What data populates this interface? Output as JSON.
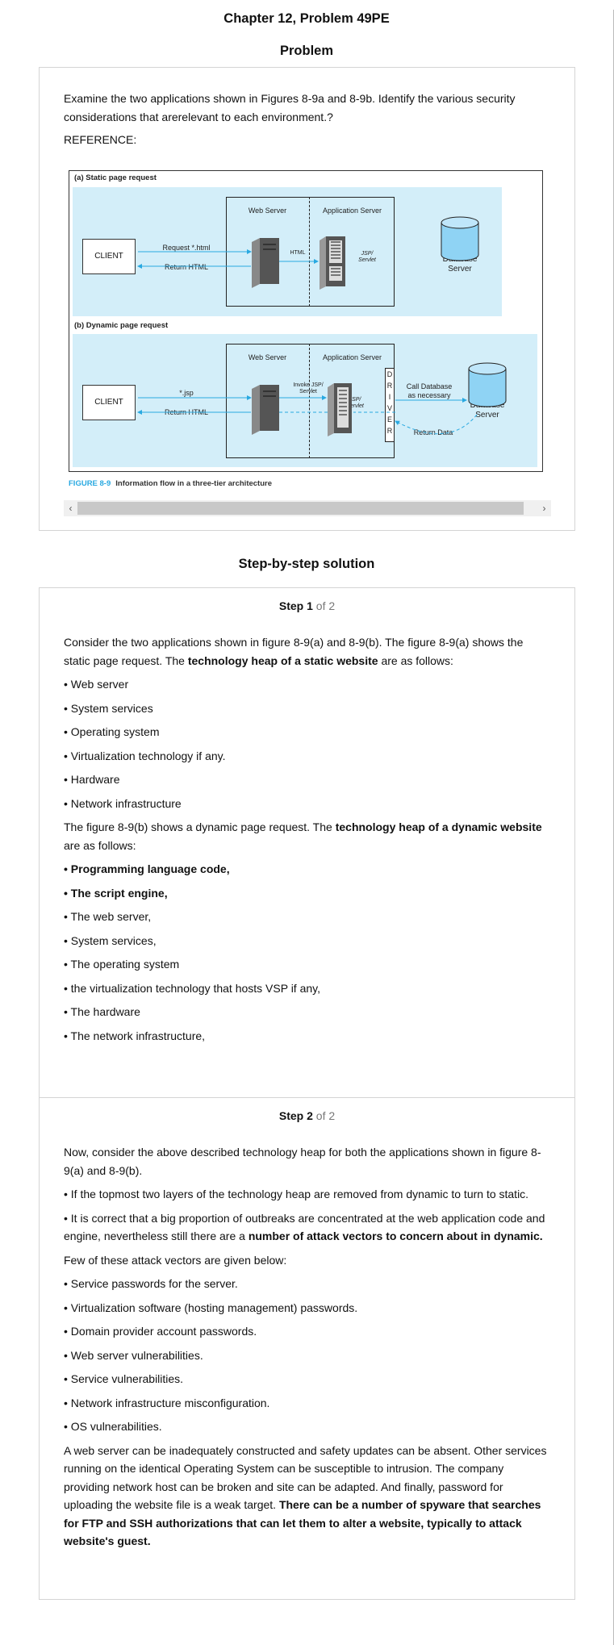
{
  "header": {
    "title": "Chapter 12, Problem 49PE"
  },
  "problem": {
    "heading": "Problem",
    "text": "Examine the two applications shown in Figures 8-9a and 8-9b. Identify the various security considerations that arerelevant to each environment.?",
    "reference": "REFERENCE:"
  },
  "figure": {
    "panel_a_label": "(a) Static page request",
    "panel_b_label": "(b) Dynamic page request",
    "web_server": "Web Server",
    "app_server": "Application Server",
    "client": "CLIENT",
    "request_html": "Request *.html",
    "return_html": "Return HTML",
    "html": "HTML",
    "jsp": "JSP/",
    "servlet": "Servlet",
    "database": "Database",
    "server": "Server",
    "request_jsp": "*.jsp",
    "invoke": "Invoke JSP/",
    "driver": [
      "D",
      "R",
      "I",
      "V",
      "E",
      "R"
    ],
    "call_db": "Call Database",
    "as_necessary": "as necessary",
    "return_data": "Return Data",
    "caption_num": "FIGURE 8-9",
    "caption": "Information flow in a three-tier architecture"
  },
  "solution": {
    "heading": "Step-by-step solution",
    "step_word": "Step",
    "step1_num": "1",
    "step2_num": "2",
    "of_total": "of 2",
    "s1": {
      "intro_a": "Consider the two applications shown in figure 8-9(a) and 8-9(b). The figure 8-9(a) shows the static page request. The ",
      "intro_b": "technology heap of a static website",
      "intro_c": " are as follows:",
      "static_items": [
        "• Web server",
        "• System services",
        "• Operating system",
        "• Virtualization technology if any.",
        "• Hardware",
        "• Network infrastructure"
      ],
      "dyn_a": "The figure 8-9(b) shows a dynamic page request. The ",
      "dyn_b": "technology heap of a dynamic website",
      "dyn_c": " are as follows:",
      "dyn_bold_1": "• Programming language code,",
      "dyn_bold_2": "• The script engine,",
      "dyn_items": [
        "• The web server,",
        "• System services,",
        "• The operating system",
        "• the virtualization technology that hosts VSP if any,",
        "• The hardware",
        "• The network infrastructure,"
      ]
    },
    "s2": {
      "intro": "Now, consider the above described technology heap for both the applications shown in figure 8-9(a) and 8-9(b).",
      "b1": "• If the topmost two layers of the technology heap are removed from dynamic to turn to static.",
      "b2_a": "• It is correct that a big proportion of outbreaks are concentrated at the web application code and engine, nevertheless still there are a ",
      "b2_b": "number of attack vectors to concern about in dynamic.",
      "few": "Few of these attack vectors are given below:",
      "vectors": [
        "• Service passwords for the server.",
        "• Virtualization software (hosting management) passwords.",
        "• Domain provider account passwords.",
        "• Web server vulnerabilities.",
        "• Service vulnerabilities.",
        "• Network infrastructure misconfiguration.",
        "• OS vulnerabilities."
      ],
      "final_a": "A web server can be inadequately constructed and safety updates can be absent. Other services running on the identical Operating System can be susceptible to intrusion. The company providing network host can be broken and site can be adapted. And finally, password for uploading the website file is a weak target. ",
      "final_b": "There can be a number of spyware that searches for FTP and SSH authorizations that can let them to alter a website, typically to attack website's guest."
    }
  }
}
